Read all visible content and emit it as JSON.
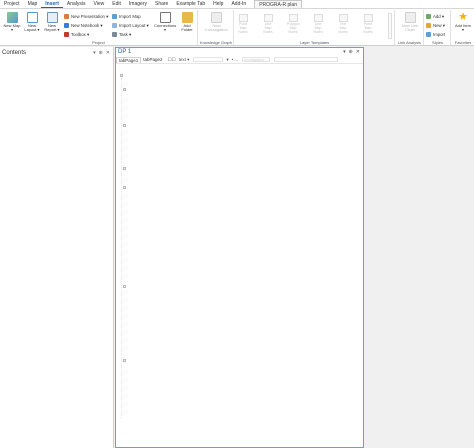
{
  "menu": {
    "tabs": [
      "Project",
      "Map",
      "Insert",
      "Analysis",
      "View",
      "Edit",
      "Imagery",
      "Share",
      "Example Tab",
      "Help",
      "Add-In"
    ],
    "active": "Insert",
    "context_tab": "PROGRA-R  plan"
  },
  "ribbon": {
    "project": {
      "label": "Project",
      "new_map": "New Map",
      "new_layout": "New Layout",
      "new_report": "New Report",
      "new_presentation": "New Presentation",
      "new_notebook": "New Notebook",
      "toolbox": "Toolbox",
      "import_map": "Import Map",
      "import_layout": "Import Layout",
      "task": "Task",
      "connections": "Connections",
      "add_folder": "Add Folder"
    },
    "knowledge_graph": {
      "label": "Knowledge Graph",
      "new_investigation": "New Investigation"
    },
    "layer_templates": {
      "label": "Layer Templates",
      "items": [
        "Point Map Notes",
        "Line Map Notes",
        "Polygon Map Notes",
        "Line Map Notes",
        "Text Map Notes",
        "Point Map Notes"
      ]
    },
    "link_analysis": {
      "label": "Link Analysis",
      "new_link_chart": "New Link Chart"
    },
    "styles": {
      "label": "Styles",
      "add": "Add",
      "new": "New",
      "import": "Import"
    },
    "favorites": {
      "label": "Favorites",
      "add_item": "Add Item"
    }
  },
  "contents": {
    "title": "Contents",
    "ctrls": [
      "▾",
      "⊕",
      "✕"
    ]
  },
  "document": {
    "title": "DP 1",
    "ctrls": [
      "▾",
      "⊕",
      "✕"
    ],
    "tabs": [
      "tabPage1",
      "tabPage2"
    ],
    "toolbar": [
      "☐☐",
      "text ▾",
      "▾",
      "• ..."
    ],
    "search_placeholder": "Investigation"
  },
  "colors": {
    "accent": "#1a5fb4",
    "doc_border": "#5ea1e6"
  }
}
